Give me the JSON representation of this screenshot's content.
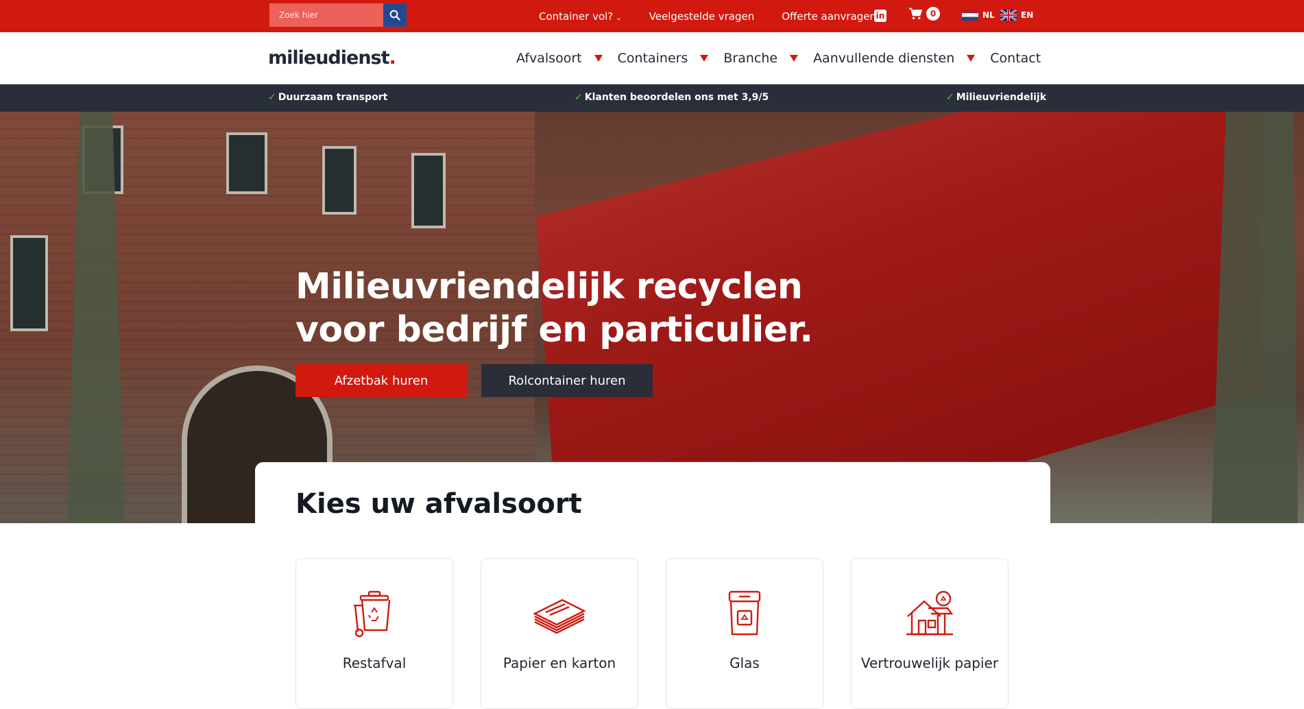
{
  "topbar": {
    "search_placeholder": "Zoek hier",
    "links": [
      {
        "label": "Container vol?",
        "caret": "⌄"
      },
      {
        "label": "Veelgestelde vragen"
      },
      {
        "label": "Offerte aanvragen"
      }
    ],
    "linkedin_icon": "in",
    "cart_count": "0",
    "languages": [
      {
        "code": "NL",
        "flag": "netherlands-flag-icon"
      },
      {
        "code": "EN",
        "flag": "uk-flag-icon"
      }
    ]
  },
  "logo": {
    "text": "milieudienst",
    "dot": "."
  },
  "nav": {
    "items": [
      {
        "label": "Afvalsoort",
        "dropdown": true
      },
      {
        "label": "Containers",
        "dropdown": true
      },
      {
        "label": "Branche",
        "dropdown": true
      },
      {
        "label": "Aanvullende diensten",
        "dropdown": true
      },
      {
        "label": "Contact",
        "dropdown": false
      }
    ]
  },
  "usp": [
    {
      "check": "✓",
      "text": "Duurzaam transport"
    },
    {
      "check": "✓",
      "text": "Klanten beoordelen ons met 3,9/5"
    },
    {
      "check": "✓",
      "text": "Milieuvriendelijk"
    }
  ],
  "hero": {
    "title_line1": "Milieuvriendelijk recyclen",
    "title_line2": "voor bedrijf en particulier.",
    "primary_button": "Afzetbak huren",
    "secondary_button": "Rolcontainer huren"
  },
  "waste_section": {
    "title": "Kies uw afvalsoort",
    "tiles": [
      {
        "label": "Restafval",
        "icon": "waste-bin-icon"
      },
      {
        "label": "Papier en karton",
        "icon": "paper-stack-icon"
      },
      {
        "label": "Glas",
        "icon": "glass-bin-icon"
      },
      {
        "label": "Vertrouwelijk papier",
        "icon": "confidential-paper-icon"
      }
    ]
  },
  "colors": {
    "brand_red": "#d2190f",
    "dark": "#2a2e38",
    "search_button": "#234a91",
    "check_green": "#5bbf3a"
  }
}
